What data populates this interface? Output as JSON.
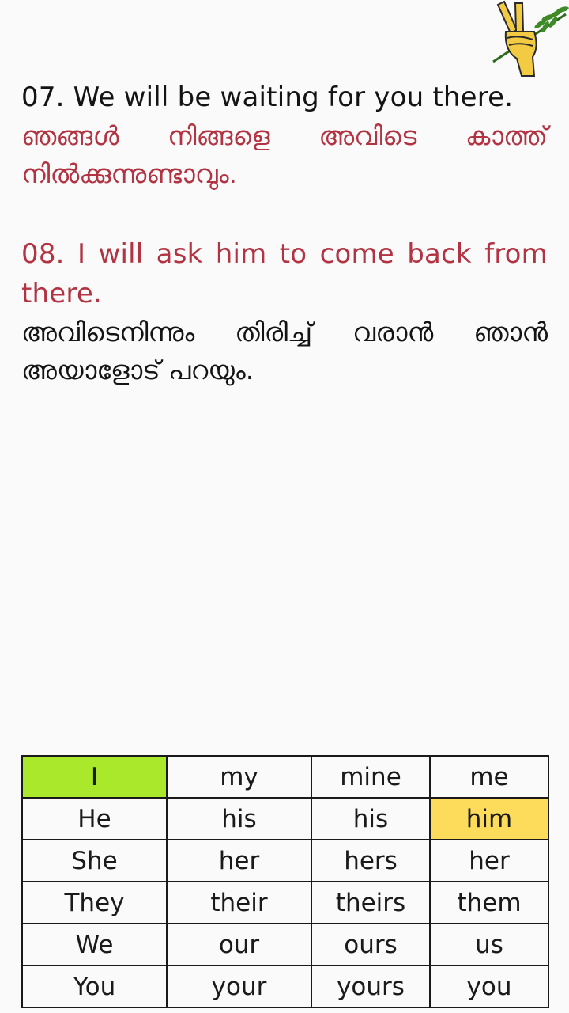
{
  "logo": {
    "icon": "peace-hand-olive-branch-icon"
  },
  "sentences": [
    {
      "english": "07. We will be waiting for you there.",
      "malayalam": "ഞങ്ങൾ നിങ്ങളെ അവിടെ കാത്ത് നിൽക്കുന്നുണ്ടാവും."
    },
    {
      "english": "08. I will ask him to come back from there.",
      "malayalam": "അവിടെനിന്നും തിരിച്ച് വരാൻ ഞാൻ അയാളോട് പറയും."
    }
  ],
  "colors": {
    "english_highlight": "#b23443",
    "green_cell": "#a9e82a",
    "yellow_cell": "#fddc5c"
  },
  "pronoun_table": [
    [
      "I",
      "my",
      "mine",
      "me"
    ],
    [
      "He",
      "his",
      "his",
      "him"
    ],
    [
      "She",
      "her",
      "hers",
      "her"
    ],
    [
      "They",
      "their",
      "theirs",
      "them"
    ],
    [
      "We",
      "our",
      "ours",
      "us"
    ],
    [
      "You",
      "your",
      "yours",
      "you"
    ]
  ],
  "highlighted_cells": {
    "green": "I (row 1, col 1)",
    "yellow": "him (row 2, col 4)"
  }
}
